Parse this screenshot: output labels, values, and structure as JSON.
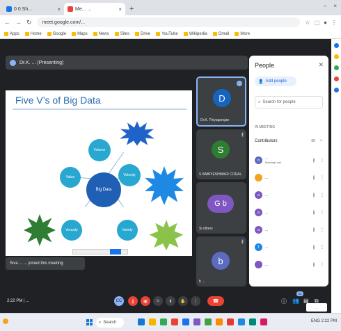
{
  "browser": {
    "tabs": [
      {
        "label": "0 0 Sh...",
        "active": false
      },
      {
        "label": "Me... ...",
        "active": true
      }
    ],
    "new_tab": "+",
    "url": "meet.google.com/..."
  },
  "bookmarks": [
    "Apps",
    "Home",
    "Google",
    "Maps",
    "News",
    "Sites",
    "Drive",
    "YouTube",
    "Wikipedia",
    "Gmail",
    "More"
  ],
  "presenter": {
    "label": "Dr.K. ... (Presenting)"
  },
  "slide": {
    "title": "Five  V’s of Big Data",
    "center": "Big Data",
    "circles": [
      "Volume",
      "Velocity",
      "Variety",
      "Veracity",
      "Value"
    ],
    "search_placeholder": "..."
  },
  "toast": "Siva ... ... joined this meeting",
  "tiles": [
    {
      "initial": "D",
      "name": "Dr.K. Thiyagarajan",
      "color": "#1565c0"
    },
    {
      "initial": "S",
      "name": "S BABIYESHWARI CORAL",
      "color": "#2e7d32"
    },
    {
      "initial": "G b",
      "name": "Si others",
      "color": "#7e57c2"
    },
    {
      "initial": "b",
      "name": "b ...",
      "color": "#5c6bc0"
    }
  ],
  "people": {
    "title": "People",
    "add_label": "Add people",
    "search_placeholder": "Search for people",
    "section": "IN MEETING",
    "contributors": "Contributors",
    "count": "60",
    "list": [
      {
        "initial": "b",
        "name": "...",
        "sub": "Meeting host",
        "color": "#5c6bc0"
      },
      {
        "initial": "",
        "name": "...",
        "sub": "",
        "color": "#f4a31a"
      },
      {
        "initial": "a",
        "name": "...",
        "sub": "",
        "color": "#7e57c2"
      },
      {
        "initial": "a",
        "name": "...",
        "sub": "",
        "color": "#7e57c2"
      },
      {
        "initial": "a",
        "name": "...",
        "sub": "",
        "color": "#7e57c2"
      },
      {
        "initial": "T",
        "name": "...",
        "sub": "",
        "color": "#1e88e5"
      },
      {
        "initial": "",
        "name": "...",
        "sub": "",
        "color": "#7e57c2"
      }
    ]
  },
  "footer": {
    "clock": "2:22 PM | ...",
    "badge": "60",
    "tooltip": "..."
  },
  "taskbar": {
    "search_label": "Search",
    "tray_text": "ENG 2:22 PM"
  }
}
